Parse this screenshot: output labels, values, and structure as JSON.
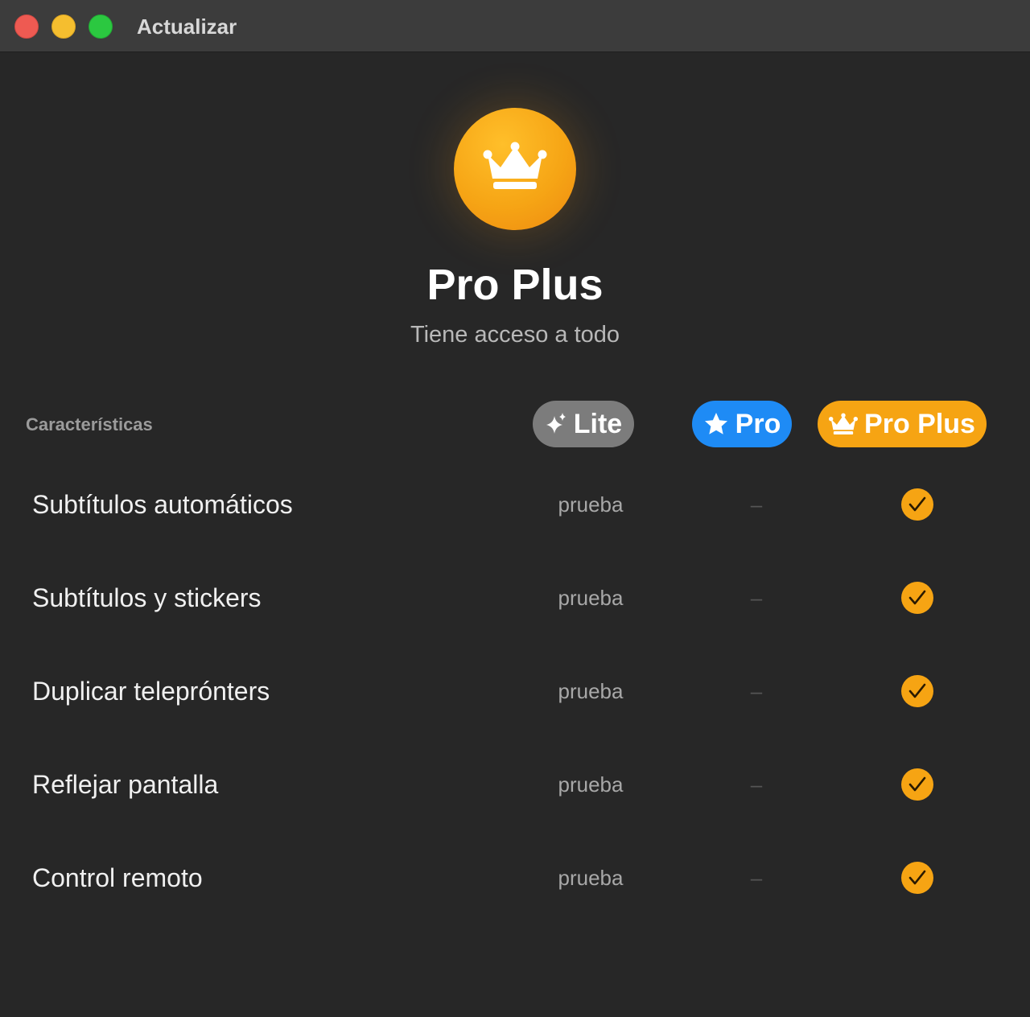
{
  "window": {
    "title": "Actualizar",
    "controls": [
      "close",
      "minimize",
      "maximize"
    ]
  },
  "hero": {
    "icon": "crown-icon",
    "title": "Pro Plus",
    "subtitle": "Tiene acceso a todo"
  },
  "table": {
    "features_label": "Características",
    "plans": [
      {
        "label": "Lite",
        "icon": "sparkles-icon",
        "color": "#7c7c7c"
      },
      {
        "label": "Pro",
        "icon": "star-icon",
        "color": "#1e8bf5"
      },
      {
        "label": "Pro Plus",
        "icon": "crown-icon",
        "color": "#f6a413"
      }
    ],
    "rows": [
      {
        "feature": "Subtítulos automáticos",
        "lite": "prueba",
        "pro": "–",
        "pro_plus": "check"
      },
      {
        "feature": "Subtítulos y stickers",
        "lite": "prueba",
        "pro": "–",
        "pro_plus": "check"
      },
      {
        "feature": "Duplicar teleprónters",
        "lite": "prueba",
        "pro": "–",
        "pro_plus": "check"
      },
      {
        "feature": "Reflejar pantalla",
        "lite": "prueba",
        "pro": "–",
        "pro_plus": "check"
      },
      {
        "feature": "Control remoto",
        "lite": "prueba",
        "pro": "–",
        "pro_plus": "check"
      }
    ]
  },
  "colors": {
    "accent": "#f6a413",
    "pro_blue": "#1e8bf5",
    "lite_gray": "#7c7c7c",
    "background": "#272727"
  }
}
